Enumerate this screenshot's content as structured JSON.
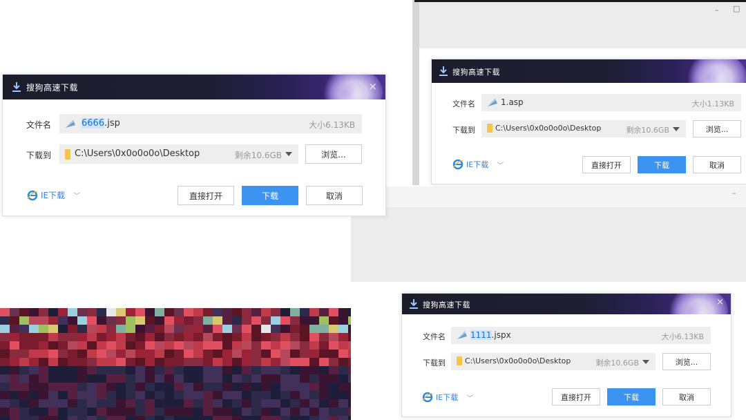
{
  "dialogs": [
    {
      "title": "搜狗高速下载",
      "close_label": "×",
      "filename_label": "文件名",
      "filename_selected": "6666",
      "filename_ext": ".jsp",
      "size": "大小6.13KB",
      "saveto_label": "下载到",
      "path": "C:\\Users\\0x0o0o0o\\Desktop",
      "free_space": "剩余10.6GB",
      "browse_label": "浏览...",
      "ie_label": "IE下载",
      "open_label": "直接打开",
      "download_label": "下载",
      "cancel_label": "取消"
    },
    {
      "title": "搜狗高速下载",
      "close_label": "",
      "filename_label": "文件名",
      "filename_selected": "",
      "filename_ext": "1.asp",
      "size": "大小1.13KB",
      "saveto_label": "下载到",
      "path": "C:\\Users\\0x0o0o0o\\Desktop",
      "free_space": "剩余10.6GB",
      "browse_label": "浏览...",
      "ie_label": "IE下载",
      "open_label": "直接打开",
      "download_label": "下载",
      "cancel_label": "取消"
    },
    {
      "title": "搜狗高速下载",
      "close_label": "×",
      "filename_label": "文件名",
      "filename_selected": "1111",
      "filename_ext": ".jspx",
      "size": "大小6.13KB",
      "saveto_label": "下载到",
      "path": "C:\\Users\\0x0o0o0o\\Desktop",
      "free_space": "剩余10.6GB",
      "browse_label": "浏览...",
      "ie_label": "IE下载",
      "open_label": "直接打开",
      "download_label": "下载",
      "cancel_label": "取消"
    }
  ],
  "window_controls": {
    "minimize": "–",
    "maximize": "□"
  },
  "colors": {
    "primary_button": "#3c93f0",
    "titlebar": "#1b1c2b",
    "link": "#3a7fd5",
    "selection": "#cfe3f9"
  }
}
